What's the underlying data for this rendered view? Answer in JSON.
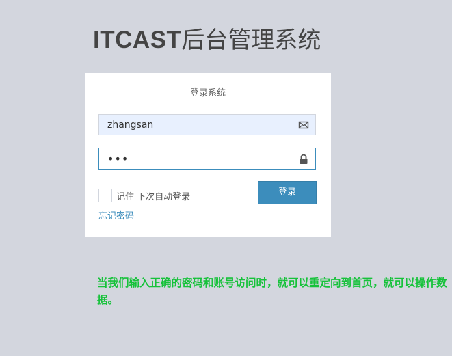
{
  "header": {
    "brand": "ITCAST",
    "title_rest": "后台管理系统"
  },
  "login": {
    "box_title": "登录系统",
    "username_value": "zhangsan",
    "password_value": "•••",
    "remember_label": "记住 下次自动登录",
    "login_button": "登录",
    "forgot_link": "忘记密码"
  },
  "icons": {
    "username": "envelope-icon",
    "password": "lock-icon"
  },
  "annotation": {
    "text": "当我们输入正确的密码和账号访问时，就可以重定向到首页，就可以操作数据。"
  },
  "colors": {
    "page_background": "#d3d6de",
    "accent": "#3c8dbc",
    "annotation": "#16c23a",
    "autofill_background": "#e8f0fe"
  }
}
